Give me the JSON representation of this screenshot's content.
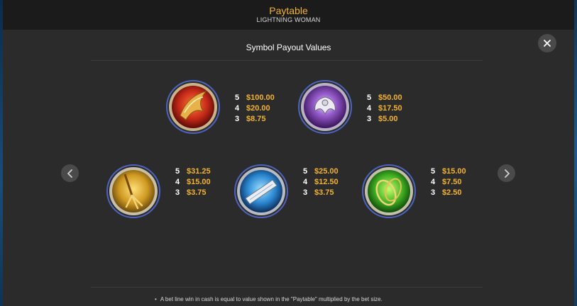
{
  "header": {
    "title": "Paytable",
    "subtitle": "LIGHTNING WOMAN"
  },
  "section": {
    "title": "Symbol Payout Values"
  },
  "symbols": [
    {
      "icon": "flaming-phoenix-icon",
      "color": "#d9412a",
      "payouts": [
        {
          "count": "5",
          "value": "$100.00"
        },
        {
          "count": "4",
          "value": "$20.00"
        },
        {
          "count": "3",
          "value": "$8.75"
        }
      ]
    },
    {
      "icon": "silver-eagle-icon",
      "color": "#7a3fb0",
      "payouts": [
        {
          "count": "5",
          "value": "$50.00"
        },
        {
          "count": "4",
          "value": "$17.50"
        },
        {
          "count": "3",
          "value": "$5.00"
        }
      ]
    },
    {
      "icon": "golden-trident-icon",
      "color": "#d9a62a",
      "payouts": [
        {
          "count": "5",
          "value": "$31.25"
        },
        {
          "count": "4",
          "value": "$15.00"
        },
        {
          "count": "3",
          "value": "$3.75"
        }
      ]
    },
    {
      "icon": "scroll-icon",
      "color": "#2f8fd6",
      "payouts": [
        {
          "count": "5",
          "value": "$25.00"
        },
        {
          "count": "4",
          "value": "$12.50"
        },
        {
          "count": "3",
          "value": "$3.75"
        }
      ]
    },
    {
      "icon": "lightning-rings-icon",
      "color": "#4fbf2a",
      "payouts": [
        {
          "count": "5",
          "value": "$15.00"
        },
        {
          "count": "4",
          "value": "$7.50"
        },
        {
          "count": "3",
          "value": "$2.50"
        }
      ]
    }
  ],
  "footer": {
    "note": "A bet line win in cash is equal to value shown in the \"Paytable\" multiplied by the bet size."
  },
  "icons": {
    "close": "close-icon",
    "prev": "chevron-left-icon",
    "next": "chevron-right-icon"
  },
  "colors": {
    "accent": "#f2b233",
    "panel": "#2b2b2b",
    "header": "#1b1b1b"
  }
}
